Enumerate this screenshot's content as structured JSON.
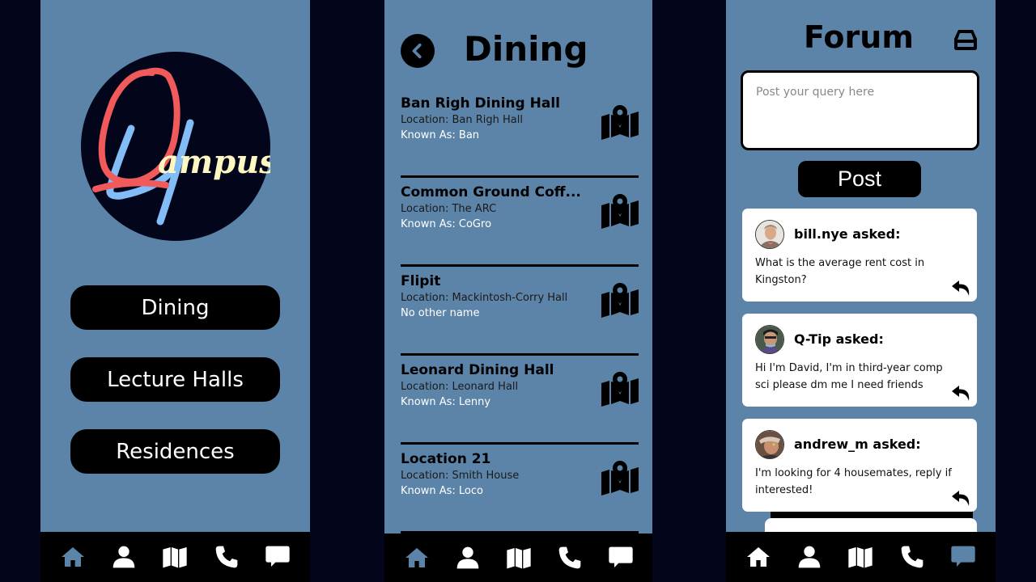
{
  "colors": {
    "screen_bg": "#5c84a8",
    "page_bg": "#03061b",
    "nav_bg": "#000000",
    "nav_active": "#5c84a8",
    "logo_red": "#f05a5a",
    "logo_blue": "#82bdf7",
    "logo_yellow": "#fff7c2"
  },
  "home": {
    "logo_text": "Qampus",
    "buttons": [
      {
        "label": "Dining"
      },
      {
        "label": "Lecture Halls"
      },
      {
        "label": "Residences"
      }
    ],
    "active_nav": "home"
  },
  "dining": {
    "title": "Dining",
    "back_icon": "chevron-left-icon",
    "items": [
      {
        "name": "Ban Righ Dining Hall",
        "location": "Location: Ban Righ Hall",
        "aka": "Known As: Ban"
      },
      {
        "name": "Common Ground Coff...",
        "location": "Location: The ARC",
        "aka": "Known As: CoGro"
      },
      {
        "name": "Flipit",
        "location": "Location: Mackintosh-Corry Hall",
        "aka": "No other name"
      },
      {
        "name": "Leonard Dining Hall",
        "location": "Location: Leonard Hall",
        "aka": "Known As: Lenny"
      },
      {
        "name": "Location 21",
        "location": "Location: Smith House",
        "aka": "Known As: Loco"
      }
    ],
    "active_nav": "home"
  },
  "forum": {
    "title": "Forum",
    "input_placeholder": "Post your query here",
    "input_value": "",
    "post_label": "Post",
    "posts": [
      {
        "author": "bill.nye asked:",
        "body": "What is the average rent cost in Kingston?"
      },
      {
        "author": "Q-Tip asked:",
        "body": "Hi I'm David, I'm in third-year comp sci please dm me I need friends"
      },
      {
        "author": "andrew_m asked:",
        "body": "I'm looking for 4 housemates, reply if interested!"
      }
    ],
    "active_nav": "forum"
  },
  "nav": {
    "items": [
      {
        "id": "home",
        "icon": "home-icon"
      },
      {
        "id": "profile",
        "icon": "user-icon"
      },
      {
        "id": "map",
        "icon": "map-icon"
      },
      {
        "id": "contact",
        "icon": "phone-icon"
      },
      {
        "id": "forum",
        "icon": "chat-icon"
      }
    ]
  }
}
